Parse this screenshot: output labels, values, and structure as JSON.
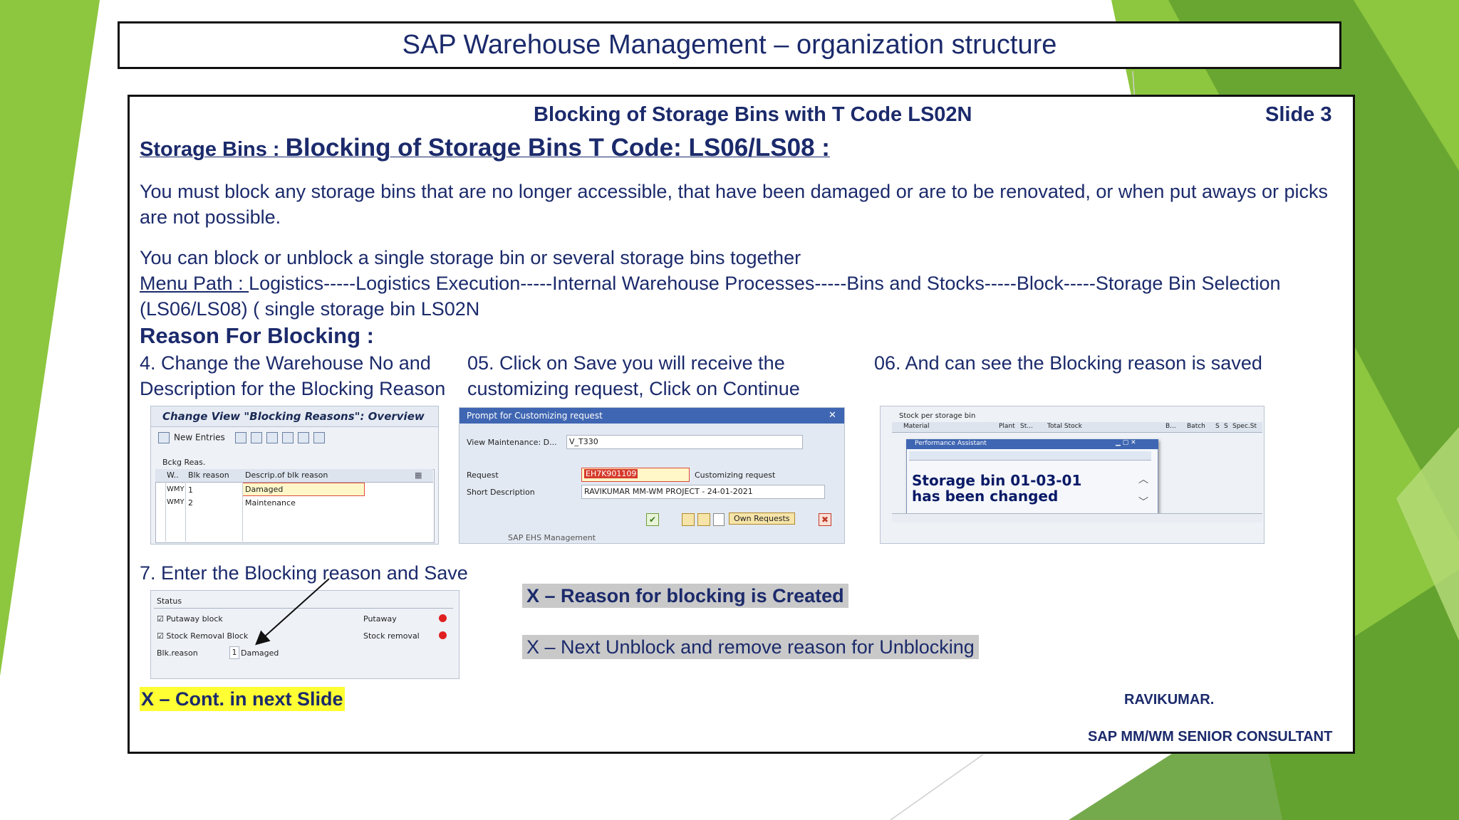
{
  "title": "SAP Warehouse Management – organization structure",
  "header": {
    "subtitle": "Blocking of Storage Bins  with T Code LS02N",
    "slide_number": "Slide 3"
  },
  "section": {
    "prefix": "Storage Bins : ",
    "heading": "Blocking of Storage Bins T Code: LS06/LS08 :"
  },
  "paragraphs": {
    "p1": "You must block any storage bins that are no longer accessible, that have been damaged or are to be renovated, or when put aways or picks are not possible.",
    "p2": "You can block or unblock a single storage bin or several storage bins together",
    "menu_label": "Menu Path : ",
    "menu_path": "Logistics-----Logistics Execution-----Internal Warehouse Processes-----Bins and Stocks-----Block-----Storage Bin Selection (LS06/LS08) ( single storage bin LS02N"
  },
  "reason_heading": "Reason For Blocking  :",
  "steps": {
    "s4": "4. Change the Warehouse No and Description for the Blocking Reason",
    "s5": "05. Click on Save you will receive the  customizing request, Click on Continue",
    "s6": "06. And can see the Blocking reason is saved",
    "s7": "7. Enter the Blocking reason and Save"
  },
  "notes": {
    "created": "X – Reason for blocking is Created",
    "next": " X – Next Unblock and remove reason for Unblocking",
    "cont": "X – Cont. in next Slide"
  },
  "author": {
    "name": "RAVIKUMAR.",
    "role": "SAP MM/WM  SENIOR CONSULTANT"
  },
  "shot1": {
    "title": "Change View \"Blocking Reasons\": Overview",
    "new_entries": "New Entries",
    "group": "Bckg Reas.",
    "col_w": "W..",
    "col_reason": "Blk reason",
    "col_desc": "Descrip.of blk reason",
    "rows": [
      {
        "w": "WMY",
        "reason": "1",
        "desc": "Damaged"
      },
      {
        "w": "WMY",
        "reason": "2",
        "desc": "Maintenance"
      }
    ]
  },
  "shot2": {
    "title": "Prompt for Customizing request",
    "view_label": "View Maintenance: D...",
    "view_value": "V_T330",
    "request_label": "Request",
    "request_value": "EH7K901109",
    "customizing": "Customizing request",
    "short_label": "Short Description",
    "short_value": "RAVIKUMAR MM-WM PROJECT - 24-01-2021",
    "own_requests": "Own Requests",
    "bottom_text": "SAP EHS Management"
  },
  "shot3": {
    "top_label": "Stock per storage bin",
    "cols": [
      "Material",
      "Plant",
      "St...",
      "Total Stock",
      "B...",
      "Batch",
      "S",
      "S",
      "Spec.St"
    ],
    "popup_title": "Performance Assistant",
    "message_line1": "Storage bin 01-03-01",
    "message_line2": "has been changed"
  },
  "shot4": {
    "status": "Status",
    "putaway_block": "Putaway block",
    "stock_removal_block": "Stock Removal Block",
    "putaway": "Putaway",
    "stock_removal": "Stock removal",
    "blk_reason_label": "Blk.reason",
    "blk_reason_value": "1",
    "blk_reason_desc": "Damaged"
  },
  "colors": {
    "navy": "#1b2a6b",
    "green_light": "#8dc63f",
    "green_dark": "#5d9b2d",
    "highlight_yellow": "#ffff33",
    "highlight_grey": "#c9c9c9"
  }
}
